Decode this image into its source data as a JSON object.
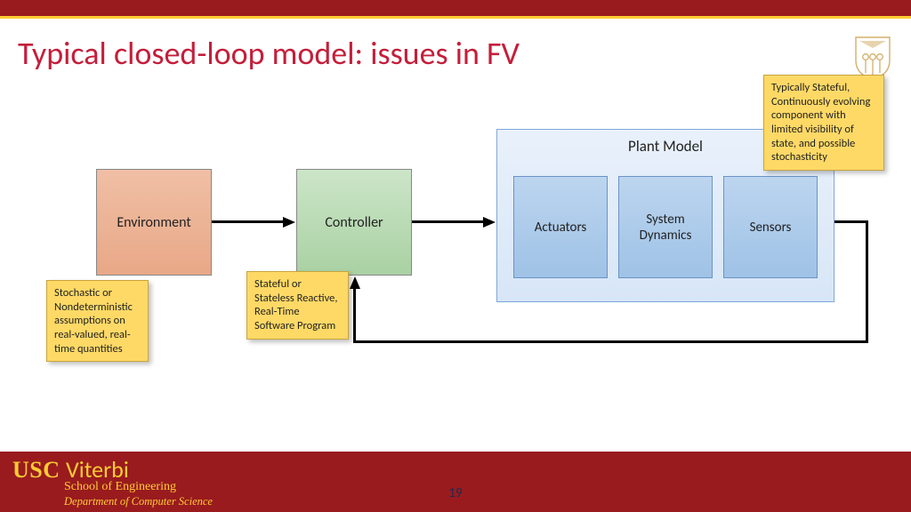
{
  "title": "Typical closed-loop model: issues in FV",
  "boxes": {
    "environment": "Environment",
    "controller": "Controller",
    "plant_title": "Plant Model",
    "actuators": "Actuators",
    "dynamics": "System\nDynamics",
    "sensors": "Sensors"
  },
  "notes": {
    "environment": "Stochastic or Nondeterministic assumptions on real-valued, real-time quantities",
    "controller": "Stateful or Stateless Reactive, Real-Time Software Program",
    "plant": "Typically Stateful, Continuously evolving component with limited visibility of state, and possible stochasticity"
  },
  "footer": {
    "usc": "USC",
    "viterbi": "Viterbi",
    "soe": "School of Engineering",
    "dcs": "Department of  Computer Science",
    "page": "19"
  }
}
